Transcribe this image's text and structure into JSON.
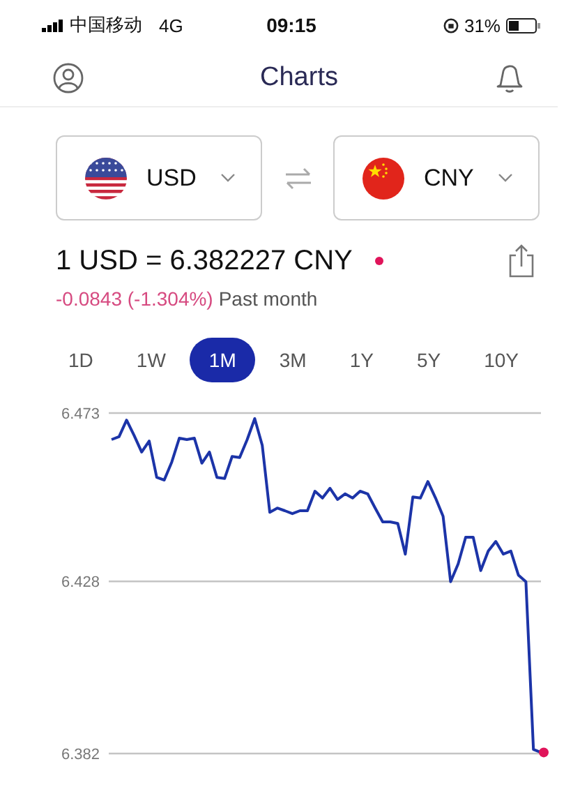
{
  "status_bar": {
    "carrier": "中国移动",
    "network": "4G",
    "time": "09:15",
    "battery": "31%"
  },
  "header": {
    "title": "Charts"
  },
  "pair": [
    {
      "code": "USD"
    },
    {
      "code": "CNY"
    }
  ],
  "rate": {
    "text": "1 USD = 6.382227 CNY",
    "change": "-0.0843 (-1.304%)",
    "period": "Past month"
  },
  "ranges": [
    {
      "label": "1D",
      "selected": false
    },
    {
      "label": "1W",
      "selected": false
    },
    {
      "label": "1M",
      "selected": true
    },
    {
      "label": "3M",
      "selected": false
    },
    {
      "label": "1Y",
      "selected": false
    },
    {
      "label": "5Y",
      "selected": false
    },
    {
      "label": "10Y",
      "selected": false
    }
  ],
  "chart_data": {
    "type": "line",
    "ylim": [
      6.382,
      6.473
    ],
    "yticks": [
      6.382,
      6.428,
      6.473
    ],
    "series": [
      {
        "color": "#1c34a8",
        "values": [
          6.4659,
          6.4667,
          6.4711,
          6.467,
          6.4626,
          6.4655,
          6.4558,
          6.4551,
          6.4599,
          6.4663,
          6.4659,
          6.4663,
          6.4596,
          6.4626,
          6.4558,
          6.4555,
          6.4614,
          6.4611,
          6.4659,
          6.4715,
          6.4644,
          6.4465,
          6.4476,
          6.4469,
          6.4461,
          6.4469,
          6.4469,
          6.4521,
          6.4503,
          6.4529,
          6.4499,
          6.4514,
          6.4503,
          6.4521,
          6.4514,
          6.4476,
          6.4439,
          6.4439,
          6.4435,
          6.4353,
          6.4506,
          6.4503,
          6.4547,
          6.4503,
          6.4454,
          6.4279,
          6.4327,
          6.4398,
          6.4398,
          6.4309,
          6.4361,
          6.4387,
          6.4353,
          6.4361,
          6.4297,
          6.4279,
          6.3831,
          6.3823
        ]
      }
    ]
  }
}
